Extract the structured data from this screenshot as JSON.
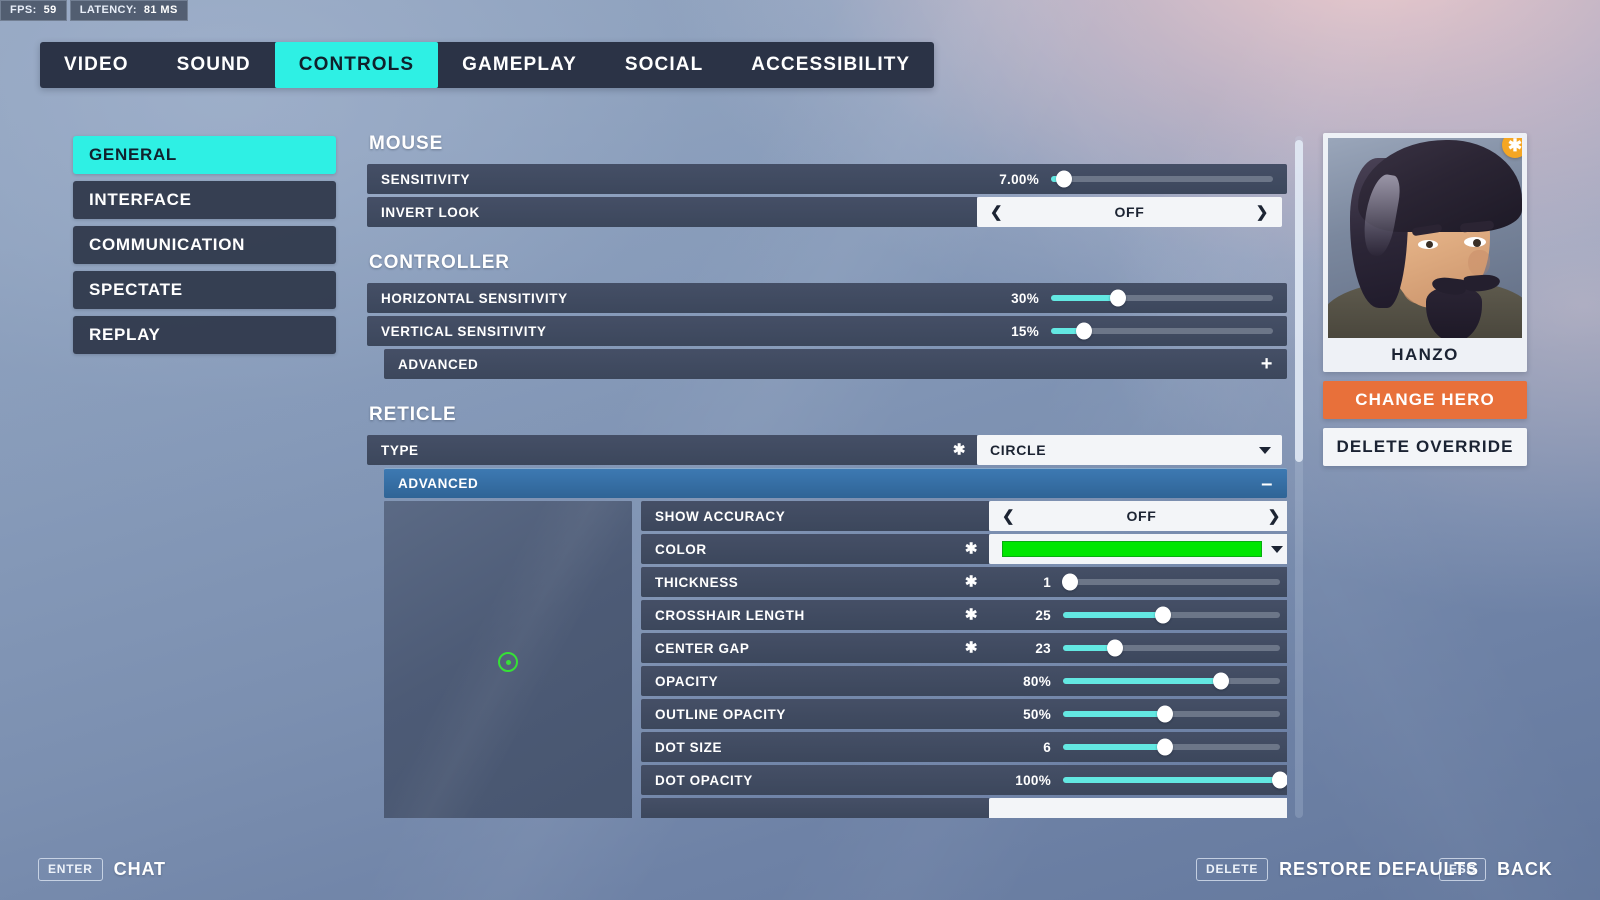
{
  "perf": {
    "fps_label": "FPS:",
    "fps_value": "59",
    "latency_label": "LATENCY:",
    "latency_value": "81 MS"
  },
  "tabs": [
    {
      "label": "VIDEO",
      "active": false
    },
    {
      "label": "SOUND",
      "active": false
    },
    {
      "label": "CONTROLS",
      "active": true
    },
    {
      "label": "GAMEPLAY",
      "active": false
    },
    {
      "label": "SOCIAL",
      "active": false
    },
    {
      "label": "ACCESSIBILITY",
      "active": false
    }
  ],
  "sidebar": {
    "items": [
      {
        "label": "GENERAL",
        "active": true
      },
      {
        "label": "INTERFACE",
        "active": false
      },
      {
        "label": "COMMUNICATION",
        "active": false
      },
      {
        "label": "SPECTATE",
        "active": false
      },
      {
        "label": "REPLAY",
        "active": false
      }
    ]
  },
  "sections": {
    "mouse": {
      "title": "MOUSE",
      "sensitivity": {
        "label": "SENSITIVITY",
        "value": "7.00%",
        "fill_pct": 6
      },
      "invert_look": {
        "label": "INVERT LOOK",
        "value": "OFF"
      }
    },
    "controller": {
      "title": "CONTROLLER",
      "horizontal": {
        "label": "HORIZONTAL SENSITIVITY",
        "value": "30%",
        "fill_pct": 30
      },
      "vertical": {
        "label": "VERTICAL SENSITIVITY",
        "value": "15%",
        "fill_pct": 15
      },
      "advanced": {
        "label": "ADVANCED",
        "toggle": "+",
        "expanded": false
      }
    },
    "reticle": {
      "title": "RETICLE",
      "type": {
        "label": "TYPE",
        "value": "CIRCLE",
        "override": "✱"
      },
      "advanced": {
        "label": "ADVANCED",
        "toggle": "–",
        "expanded": true
      },
      "preview_color": "#2ee02e",
      "rows": [
        {
          "label": "SHOW ACCURACY",
          "kind": "stepper",
          "value": "OFF",
          "override": ""
        },
        {
          "label": "COLOR",
          "kind": "color",
          "value": "#00e600",
          "override": "✱"
        },
        {
          "label": "THICKNESS",
          "kind": "slider",
          "value": "1",
          "override": "✱",
          "fill_pct": 3
        },
        {
          "label": "CROSSHAIR LENGTH",
          "kind": "slider",
          "value": "25",
          "override": "✱",
          "fill_pct": 46
        },
        {
          "label": "CENTER GAP",
          "kind": "slider",
          "value": "23",
          "override": "✱",
          "fill_pct": 24
        },
        {
          "label": "OPACITY",
          "kind": "slider",
          "value": "80%",
          "override": "",
          "fill_pct": 73
        },
        {
          "label": "OUTLINE OPACITY",
          "kind": "slider",
          "value": "50%",
          "override": "",
          "fill_pct": 47
        },
        {
          "label": "DOT SIZE",
          "kind": "slider",
          "value": "6",
          "override": "",
          "fill_pct": 47
        },
        {
          "label": "DOT OPACITY",
          "kind": "slider",
          "value": "100%",
          "override": "",
          "fill_pct": 100
        }
      ]
    }
  },
  "hero": {
    "name": "HANZO",
    "override_badge": "✱",
    "change_hero_label": "CHANGE HERO",
    "delete_override_label": "DELETE OVERRIDE",
    "accent_color": "#e8703a"
  },
  "hints": {
    "chat": {
      "key": "ENTER",
      "label": "CHAT"
    },
    "restore": {
      "key": "DELETE",
      "label": "RESTORE DEFAULTS"
    },
    "back": {
      "key": "ESC",
      "label": "BACK"
    }
  }
}
